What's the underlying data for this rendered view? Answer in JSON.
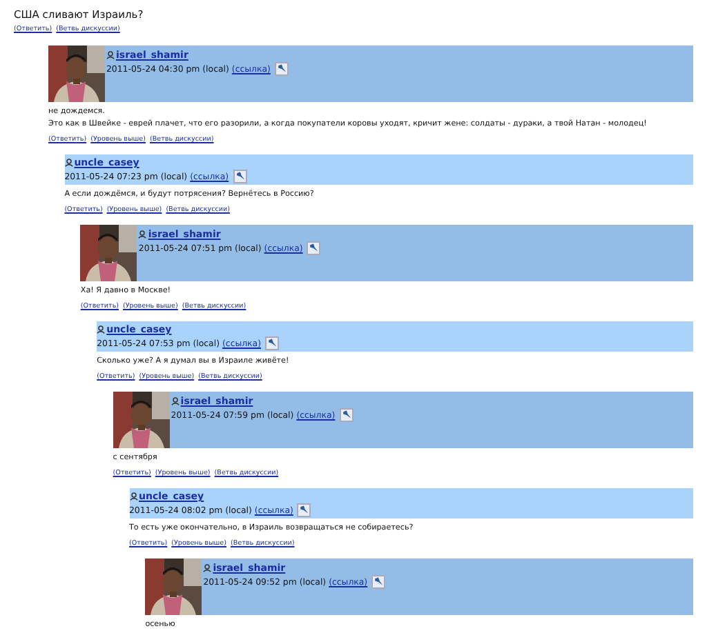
{
  "post": {
    "title": "США сливают Израиль?",
    "links": [
      "(Ответить)",
      "(Ветвь дискуссии)"
    ]
  },
  "comments": [
    {
      "user": "israel_shamir",
      "userpic": true,
      "date": "2011-05-24 04:30 pm (local)",
      "permalink": "(ссылка)",
      "body": [
        "не дождемся.",
        "Это как в Швейке - еврей плачет, что его разорили, а когда покупатели коровы уходят, кричит жене: солдаты - дураки, а твой Натан - молодец!"
      ],
      "links": [
        "(Ответить)",
        "(Уровень выше)",
        "(Ветвь дискуссии)"
      ],
      "children": [
        {
          "user": "uncle_casey",
          "userpic": false,
          "date": "2011-05-24 07:23 pm (local)",
          "permalink": "(ссылка)",
          "body": [
            "А если дождёмся, и будут потрясения? Вернётесь в Россию?"
          ],
          "links": [
            "(Ответить)",
            "(Уровень выше)",
            "(Ветвь дискуссии)"
          ],
          "children": [
            {
              "user": "israel_shamir",
              "userpic": true,
              "date": "2011-05-24 07:51 pm (local)",
              "permalink": "(ссылка)",
              "body": [
                "Ха! Я давно в Москве!"
              ],
              "links": [
                "(Ответить)",
                "(Уровень выше)",
                "(Ветвь дискуссии)"
              ],
              "children": [
                {
                  "user": "uncle_casey",
                  "userpic": false,
                  "date": "2011-05-24 07:53 pm (local)",
                  "permalink": "(ссылка)",
                  "body": [
                    "Сколько уже? А я думал вы в Израиле живёте!"
                  ],
                  "links": [
                    "(Ответить)",
                    "(Уровень выше)",
                    "(Ветвь дискуссии)"
                  ],
                  "children": [
                    {
                      "user": "israel_shamir",
                      "userpic": true,
                      "date": "2011-05-24 07:59 pm (local)",
                      "permalink": "(ссылка)",
                      "body": [
                        "с сентября"
                      ],
                      "links": [
                        "(Ответить)",
                        "(Уровень выше)",
                        "(Ветвь дискуссии)"
                      ],
                      "children": [
                        {
                          "user": "uncle_casey",
                          "userpic": false,
                          "date": "2011-05-24 08:02 pm (local)",
                          "permalink": "(ссылка)",
                          "body": [
                            "То есть уже окончательно, в Израиль возвращаться не собираетесь?"
                          ],
                          "links": [
                            "(Ответить)",
                            "(Уровень выше)",
                            "(Ветвь дискуссии)"
                          ],
                          "children": [
                            {
                              "user": "israel_shamir",
                              "userpic": true,
                              "date": "2011-05-24 09:52 pm (local)",
                              "permalink": "(ссылка)",
                              "body": [
                                "осенью"
                              ]
                            }
                          ]
                        }
                      ]
                    }
                  ]
                }
              ]
            }
          ]
        }
      ]
    }
  ]
}
